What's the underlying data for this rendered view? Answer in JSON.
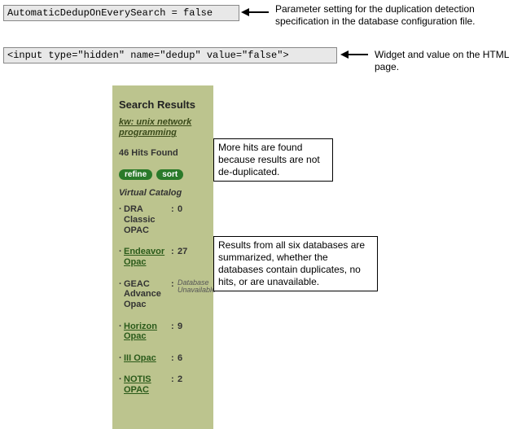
{
  "codebox1": "AutomaticDedupOnEverySearch = false",
  "annotation1": "Parameter setting for the duplication detection specification in the database configuration file.",
  "codebox2": "<input type=\"hidden\" name=\"dedup\" value=\"false\">",
  "annotation2": "Widget and value on the HTML page.",
  "callout1": "More hits are found because results are not de-duplicated.",
  "callout2": "Results from all six databases are summarized, whether the databases contain duplicates, no hits, or are unavailable.",
  "panel": {
    "heading": "Search Results",
    "query_line1": "kw: unix network",
    "query_line2": "programming",
    "hits": "46 Hits Found",
    "refine": "refine",
    "sort": "sort",
    "subhead": "Virtual Catalog",
    "items": [
      {
        "name": "DRA Classic OPAC",
        "count": "0",
        "linked": false
      },
      {
        "name": "Endeavor Opac",
        "count": "27",
        "linked": true
      },
      {
        "name": "GEAC Advance Opac",
        "count": "Database Unavailable",
        "linked": false,
        "unavailable": true
      },
      {
        "name": "Horizon Opac",
        "count": "9",
        "linked": true
      },
      {
        "name": "III Opac",
        "count": "6",
        "linked": true
      },
      {
        "name": "NOTIS OPAC",
        "count": "2",
        "linked": true
      }
    ]
  }
}
